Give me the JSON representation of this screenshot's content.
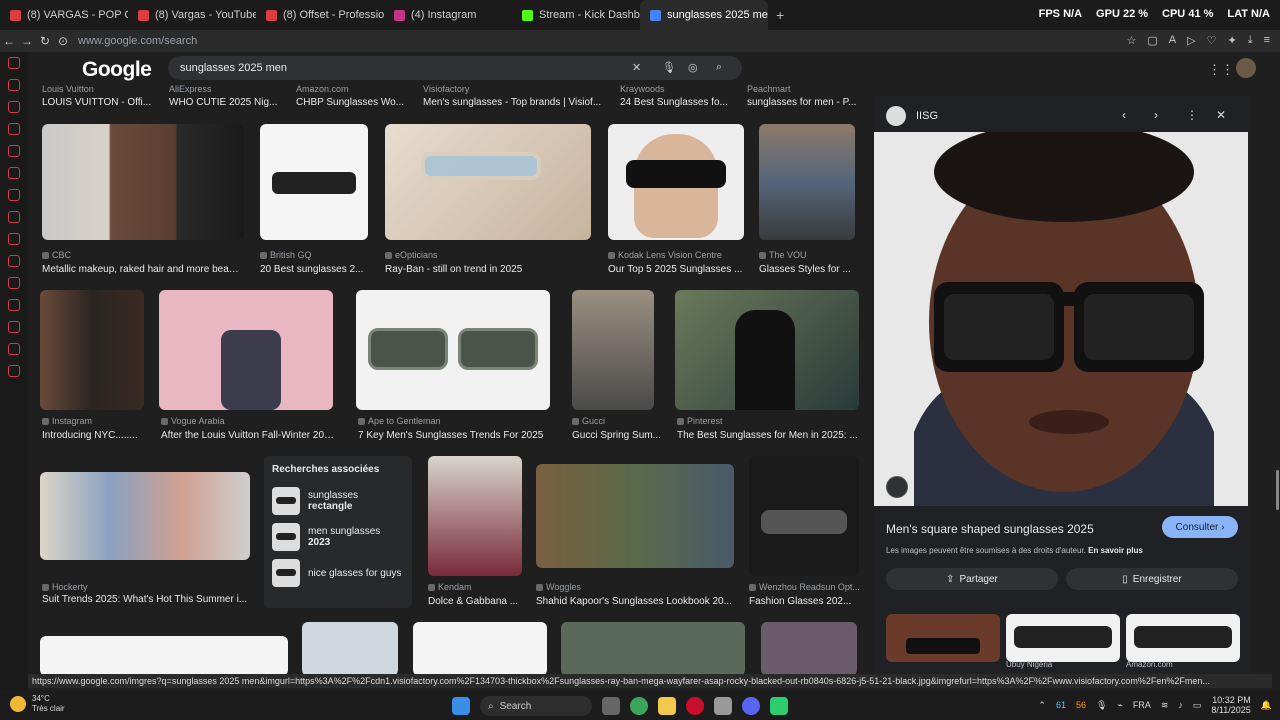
{
  "tabs": [
    {
      "label": "(8) VARGAS - POP OUT #",
      "color": "#e23b3b"
    },
    {
      "label": "(8) Vargas - YouTube",
      "color": "#e23b3b"
    },
    {
      "label": "(8) Offset - Professional",
      "color": "#e23b3b"
    },
    {
      "label": "(4) Instagram",
      "color": "#c13584"
    },
    {
      "label": "Stream - Kick Dashbo",
      "color": "#53fc18"
    },
    {
      "label": "sunglasses 2025 men - F",
      "color": "#4285f4"
    }
  ],
  "new_tab": "+",
  "stats": {
    "fps_label": "FPS",
    "fps": "N/A",
    "gpu_label": "GPU",
    "gpu": "22 %",
    "cpu_label": "CPU",
    "cpu": "41 %",
    "lat_label": "LAT",
    "lat": "N/A"
  },
  "address": {
    "url": "www.google.com/search"
  },
  "google": {
    "logo": "Google",
    "query": "sunglasses 2025 men"
  },
  "top_row": [
    {
      "source": "Louis Vuitton",
      "title": "LOUIS VUITTON - Offi..."
    },
    {
      "source": "AliExpress",
      "title": "WHO CUTIE 2025 Nig..."
    },
    {
      "source": "Amazon.com",
      "title": "CHBP Sunglasses Wo..."
    },
    {
      "source": "Visiofactory",
      "title": "Men's sunglasses - Top brands | Visiof..."
    },
    {
      "source": "Kraywoods",
      "title": "24 Best Sunglasses fo..."
    },
    {
      "source": "Peachmart",
      "title": "sunglasses for men - P..."
    }
  ],
  "results": [
    {
      "source": "CBC",
      "title": "Metallic makeup, raked hair and more beaut..."
    },
    {
      "source": "British GQ",
      "title": "20 Best sunglasses 2..."
    },
    {
      "source": "eOpticians",
      "title": "Ray-Ban - still on trend in 2025"
    },
    {
      "source": "Kodak Lens Vision Centre",
      "title": "Our Top 5 2025 Sunglasses ..."
    },
    {
      "source": "The VOU",
      "title": "Glasses Styles for ..."
    },
    {
      "source": "Instagram",
      "title": "Introducing NYC........"
    },
    {
      "source": "Vogue Arabia",
      "title": "After the Louis Vuitton Fall-Winter 2025..."
    },
    {
      "source": "Ape to Gentleman",
      "title": "7 Key Men's Sunglasses Trends For 2025"
    },
    {
      "source": "Gucci",
      "title": "Gucci Spring Sum..."
    },
    {
      "source": "Pinterest",
      "title": "The Best Sunglasses for Men in 2025: ..."
    },
    {
      "source": "Hockerty",
      "title": "Suit Trends 2025: What's Hot This Summer i..."
    },
    {
      "source": "Kendam",
      "title": "Dolce & Gabbana ..."
    },
    {
      "source": "Woggles",
      "title": "Shahid Kapoor's Sunglasses Lookbook 20..."
    },
    {
      "source": "Wenzhou Readsun Opt...",
      "title": "Fashion Glasses 202..."
    }
  ],
  "related": {
    "title": "Recherches associées",
    "items": [
      {
        "prefix": "sunglasses ",
        "bold": "rectangle"
      },
      {
        "prefix": "men sunglasses ",
        "bold": "2023"
      },
      {
        "prefix": "nice glasses for guys",
        "bold": ""
      }
    ]
  },
  "panel": {
    "source": "IISG",
    "title": "Men's square shaped sunglasses 2025",
    "consult": "Consulter",
    "rights": "Les images peuvent être soumises à des droits d'auteur.",
    "rights_link": "En savoir plus",
    "share": "Partager",
    "save": "Enregistrer",
    "thumb_captions": [
      "Ubuy Nigeria",
      "Amazon.com"
    ]
  },
  "status_url": "https://www.google.com/imgres?q=sunglasses 2025 men&imgurl=https%3A%2F%2Fcdn1.visiofactory.com%2F134703-thickbox%2Fsunglasses-ray-ban-mega-wayfarer-asap-rocky-blacked-out-rb0840s-6826-j5-51-21-black.jpg&imgrefurl=https%3A%2F%2Fwww.visiofactory.com%2Fen%2Fmen...",
  "taskbar": {
    "temp": "34°C",
    "weather": "Très clair",
    "search": "Search",
    "lang": "FRA",
    "time": "10:32 PM",
    "date": "8/11/2025",
    "badge1": "61",
    "badge2": "56"
  }
}
